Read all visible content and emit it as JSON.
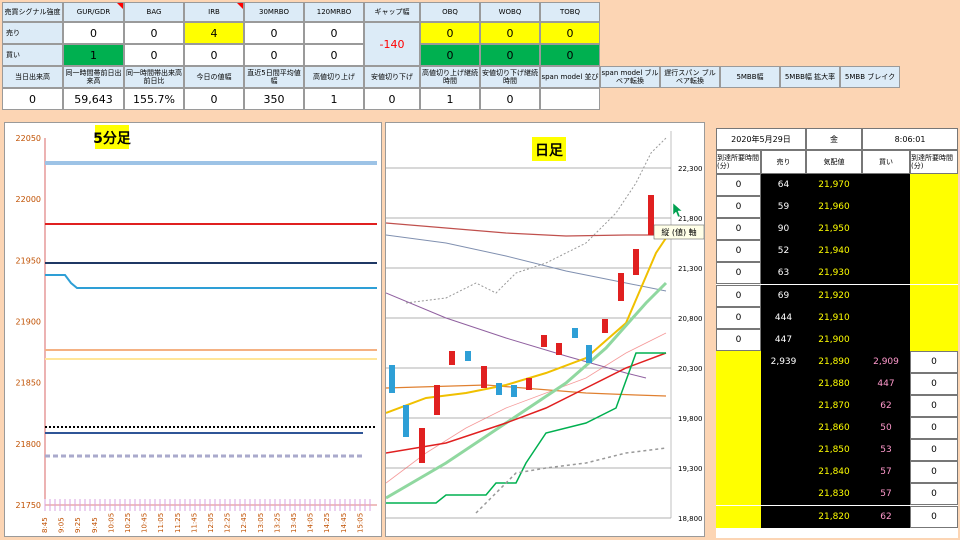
{
  "table_top": {
    "headers": [
      "売買シグナル強度",
      "GUR/GDR",
      "BAG",
      "IRB",
      "30MRBO",
      "120MRBO",
      "ギャップ幅",
      "OBQ",
      "WOBQ",
      "TOBQ"
    ],
    "sell_label": "売り",
    "buy_label": "買い",
    "sell_values": [
      "0",
      "0",
      "4",
      "0",
      "0",
      "0",
      "0",
      "0"
    ],
    "buy_values": [
      "1",
      "0",
      "0",
      "0",
      "0",
      "0",
      "0",
      "0"
    ],
    "gap_value": "-140"
  },
  "table_second": {
    "headers": [
      "当日出来高",
      "同一時間帯前日出来高",
      "同一時間帯出来高前日比",
      "今日の値幅",
      "直近5日間平均値幅",
      "高値切り上げ",
      "安値切り下げ",
      "高値切り上げ継続時間",
      "安値切り下げ継続時間",
      "span model 並び",
      "span model ブルベア転換",
      "遅行スパン ブルベア転換",
      "5MBB幅",
      "5MBB幅 拡大率",
      "5MBB ブレイク"
    ],
    "values": [
      "0",
      "59,643",
      "155.7%",
      "0",
      "350",
      "1",
      "0",
      "1",
      "0",
      "",
      "",
      "",
      "",
      "",
      ""
    ]
  },
  "chart_5min": {
    "title": "5分足",
    "y_ticks": [
      "22050",
      "22000",
      "21950",
      "21900",
      "21850",
      "21800",
      "21750"
    ],
    "x_ticks": [
      "8:45",
      "9:05",
      "9:25",
      "9:45",
      "10:05",
      "10:25",
      "10:45",
      "11:05",
      "11:25",
      "11:45",
      "12:05",
      "12:25",
      "12:45",
      "13:05",
      "13:25",
      "13:45",
      "14:05",
      "14:25",
      "14:45",
      "15:05"
    ]
  },
  "chart_daily": {
    "title": "日足",
    "y_ticks": [
      "22,300",
      "21,800",
      "21,300",
      "20,800",
      "20,300",
      "19,800",
      "19,300",
      "18,800"
    ],
    "tooltip": "縦 (値) 軸"
  },
  "board": {
    "date": "2020年5月29日",
    "weekday": "金",
    "time": "8:06:01",
    "col_headers": [
      "到達所要時間(分)",
      "売り",
      "気配値",
      "買い",
      "到達所要時間(分)"
    ],
    "rows": [
      {
        "t1": "0",
        "sell": "64",
        "price": "21,970",
        "buy": "",
        "t2": ""
      },
      {
        "t1": "0",
        "sell": "59",
        "price": "21,960",
        "buy": "",
        "t2": ""
      },
      {
        "t1": "0",
        "sell": "90",
        "price": "21,950",
        "buy": "",
        "t2": ""
      },
      {
        "t1": "0",
        "sell": "52",
        "price": "21,940",
        "buy": "",
        "t2": ""
      },
      {
        "t1": "0",
        "sell": "63",
        "price": "21,930",
        "buy": "",
        "t2": ""
      },
      {
        "t1": "0",
        "sell": "69",
        "price": "21,920",
        "buy": "",
        "t2": ""
      },
      {
        "t1": "0",
        "sell": "444",
        "price": "21,910",
        "buy": "",
        "t2": ""
      },
      {
        "t1": "0",
        "sell": "447",
        "price": "21,900",
        "buy": "",
        "t2": ""
      },
      {
        "t1": "",
        "sell": "2,939",
        "price": "21,890",
        "buy": "2,909",
        "t2": "0"
      },
      {
        "t1": "",
        "sell": "",
        "price": "21,880",
        "buy": "447",
        "t2": "0"
      },
      {
        "t1": "",
        "sell": "",
        "price": "21,870",
        "buy": "62",
        "t2": "0"
      },
      {
        "t1": "",
        "sell": "",
        "price": "21,860",
        "buy": "50",
        "t2": "0"
      },
      {
        "t1": "",
        "sell": "",
        "price": "21,850",
        "buy": "53",
        "t2": "0"
      },
      {
        "t1": "",
        "sell": "",
        "price": "21,840",
        "buy": "57",
        "t2": "0"
      },
      {
        "t1": "",
        "sell": "",
        "price": "21,830",
        "buy": "57",
        "t2": "0"
      },
      {
        "t1": "",
        "sell": "",
        "price": "21,820",
        "buy": "62",
        "t2": "0"
      }
    ]
  },
  "colors": {
    "yellow": "#ffff00",
    "green": "#00b050",
    "pink": "#ff99cc",
    "header_blue": "#dcebf7"
  }
}
